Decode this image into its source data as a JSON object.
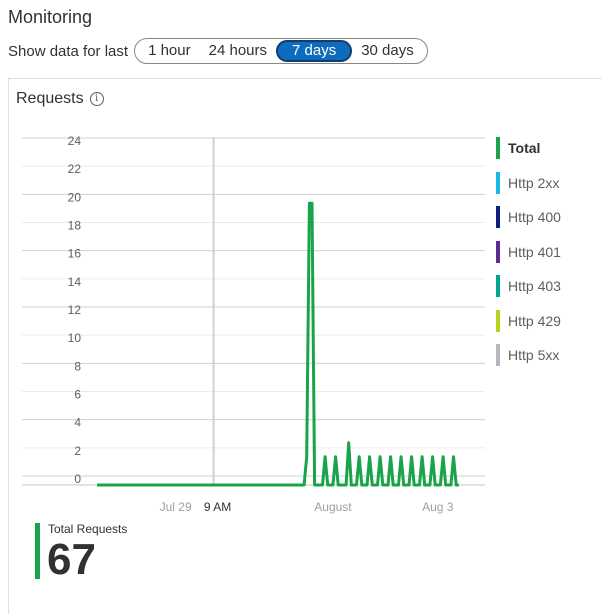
{
  "header": {
    "title": "Monitoring"
  },
  "time_range": {
    "label": "Show data for last",
    "options": [
      "1 hour",
      "24 hours",
      "7 days",
      "30 days"
    ],
    "selected": "7 days"
  },
  "card": {
    "title": "Requests",
    "info_icon": "info-icon"
  },
  "legend": [
    {
      "label": "Total",
      "color": "#1aa34a",
      "active": true
    },
    {
      "label": "Http 2xx",
      "color": "#1ab8e8"
    },
    {
      "label": "Http 400",
      "color": "#0c1f7a"
    },
    {
      "label": "Http 401",
      "color": "#5c2d91"
    },
    {
      "label": "Http 403",
      "color": "#00a78e"
    },
    {
      "label": "Http 429",
      "color": "#b6d31b"
    },
    {
      "label": "Http 5xx",
      "color": "#b3b9bf"
    }
  ],
  "summary": {
    "label": "Total Requests",
    "value": "67"
  },
  "chart_data": {
    "type": "line",
    "ylim": [
      0,
      24
    ],
    "yticks": [
      0,
      2,
      4,
      6,
      8,
      10,
      12,
      14,
      16,
      18,
      20,
      22,
      24
    ],
    "xticks": [
      {
        "label": "Jul 29",
        "x": 1.5,
        "emphasis": false
      },
      {
        "label": "9 AM",
        "x": 2.3,
        "emphasis": true
      },
      {
        "label": "August",
        "x": 4.5,
        "emphasis": false
      },
      {
        "label": "Aug 3",
        "x": 6.5,
        "emphasis": false
      }
    ],
    "xlim": [
      0,
      7.4
    ],
    "marker_x": 2.3,
    "series": [
      {
        "name": "Total",
        "color": "#1aa34a",
        "points": [
          [
            0,
            0
          ],
          [
            3.95,
            0
          ],
          [
            4.0,
            2
          ],
          [
            4.05,
            20
          ],
          [
            4.1,
            20
          ],
          [
            4.15,
            0
          ],
          [
            4.3,
            0
          ],
          [
            4.35,
            2
          ],
          [
            4.4,
            0
          ],
          [
            4.5,
            0
          ],
          [
            4.55,
            2
          ],
          [
            4.6,
            0
          ],
          [
            4.75,
            0
          ],
          [
            4.8,
            3
          ],
          [
            4.85,
            0
          ],
          [
            4.95,
            0
          ],
          [
            5.0,
            2
          ],
          [
            5.05,
            0
          ],
          [
            5.15,
            0
          ],
          [
            5.2,
            2
          ],
          [
            5.25,
            0
          ],
          [
            5.35,
            0
          ],
          [
            5.4,
            2
          ],
          [
            5.45,
            0
          ],
          [
            5.55,
            0
          ],
          [
            5.6,
            2
          ],
          [
            5.65,
            0
          ],
          [
            5.75,
            0
          ],
          [
            5.8,
            2
          ],
          [
            5.85,
            0
          ],
          [
            5.95,
            0
          ],
          [
            6.0,
            2
          ],
          [
            6.05,
            0
          ],
          [
            6.15,
            0
          ],
          [
            6.2,
            2
          ],
          [
            6.25,
            0
          ],
          [
            6.35,
            0
          ],
          [
            6.4,
            2
          ],
          [
            6.45,
            0
          ],
          [
            6.55,
            0
          ],
          [
            6.6,
            2
          ],
          [
            6.65,
            0
          ],
          [
            6.75,
            0
          ],
          [
            6.8,
            2
          ],
          [
            6.85,
            0
          ],
          [
            6.9,
            0
          ]
        ]
      }
    ]
  }
}
